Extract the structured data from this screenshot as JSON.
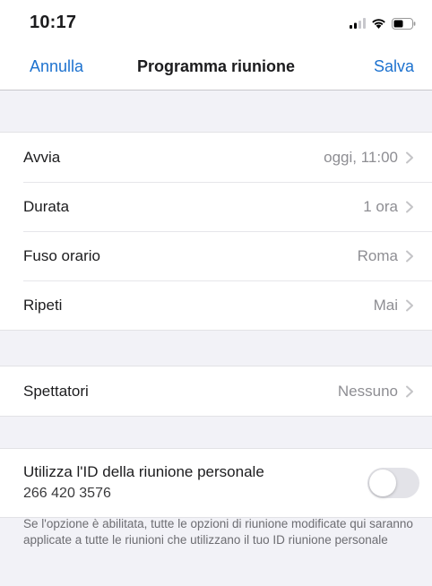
{
  "status_bar": {
    "time": "10:17"
  },
  "nav": {
    "cancel": "Annulla",
    "title": "Programma riunione",
    "save": "Salva"
  },
  "schedule_rows": [
    {
      "label": "Avvia",
      "value": "oggi, 11:00"
    },
    {
      "label": "Durata",
      "value": "1 ora"
    },
    {
      "label": "Fuso orario",
      "value": "Roma"
    },
    {
      "label": "Ripeti",
      "value": "Mai"
    }
  ],
  "viewers_row": {
    "label": "Spettatori",
    "value": "Nessuno"
  },
  "personal_id": {
    "label": "Utilizza l'ID della riunione personale",
    "number": "266 420 3576",
    "toggle_on": false,
    "footnote": "Se l'opzione è abilitata, tutte le opzioni di riunione modificate qui saranno applicate a tutte le riunioni che utilizzano il tuo ID riunione personale"
  },
  "colors": {
    "accent": "#1d72cf",
    "background": "#f2f2f7",
    "secondary_text": "#8e8e93"
  },
  "icons": [
    "cellular-signal-icon",
    "wifi-icon",
    "battery-icon",
    "chevron-right-icon"
  ]
}
